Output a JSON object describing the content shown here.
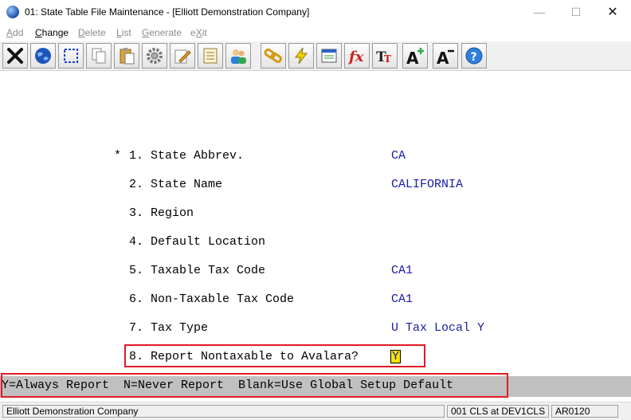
{
  "window": {
    "title": "01: State Table File Maintenance - [Elliott Demonstration Company]",
    "minimize": "—",
    "maximize": "☐",
    "close": "✕"
  },
  "menu": {
    "items": [
      {
        "key": "A",
        "rest": "dd"
      },
      {
        "key": "C",
        "rest": "hange"
      },
      {
        "key": "D",
        "rest": "elete"
      },
      {
        "key": "L",
        "rest": "ist",
        "pre": ""
      },
      {
        "key": "G",
        "rest": "enerate"
      },
      {
        "pre": "e",
        "key": "X",
        "rest": "it"
      }
    ]
  },
  "toolbar": {
    "icons": [
      "close-x-icon",
      "globe-icon",
      "select-icon",
      "copy-icon",
      "paste-icon",
      "settings-gear-icon",
      "edit-pencil-icon",
      "notes-icon",
      "users-icon",
      "links-icon",
      "lightning-icon",
      "window-icon",
      "function-fx-icon",
      "text-size-icon",
      "font-increase-icon",
      "font-decrease-icon",
      "help-icon"
    ]
  },
  "form": {
    "star": "*",
    "fields": [
      {
        "label": "1. State Abbrev.",
        "value": "CA"
      },
      {
        "label": "2. State Name",
        "value": "CALIFORNIA"
      },
      {
        "label": "3. Region",
        "value": ""
      },
      {
        "label": "4. Default Location",
        "value": ""
      },
      {
        "label": "5. Taxable Tax Code",
        "value": "CA1"
      },
      {
        "label": "6. Non-Taxable Tax Code",
        "value": "CA1"
      },
      {
        "label": "7. Tax Type",
        "value": "U Tax Local Y"
      },
      {
        "label": "8. Report Nontaxable to Avalara?",
        "value": "Y"
      }
    ]
  },
  "help_line": "Y=Always Report  N=Never Report  Blank=Use Global Setup Default",
  "status": {
    "company": "Elliott Demonstration Company",
    "session": "001 CLS at DEV1CLS",
    "program": "AR0120"
  },
  "colors": {
    "highlight_border": "#e01b24",
    "value_text": "#1a1aa6",
    "cursor_bg": "#f5e400"
  }
}
